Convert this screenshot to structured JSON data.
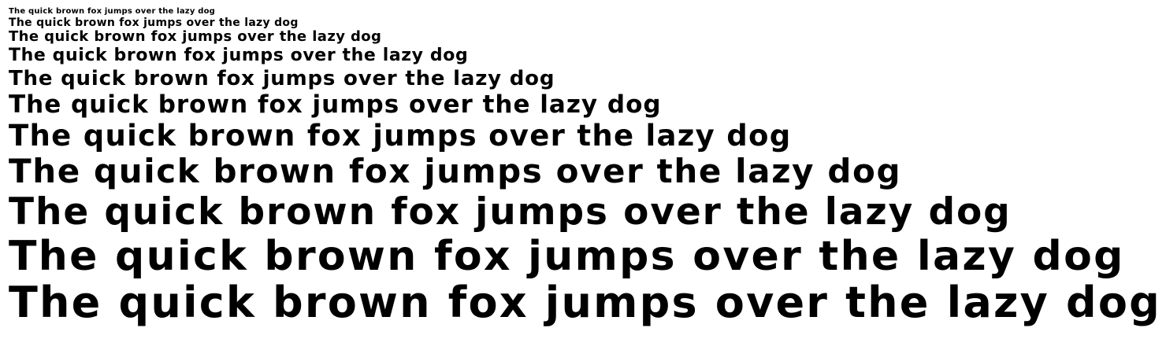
{
  "specimen": {
    "lines": [
      "The quick brown fox jumps over the lazy dog",
      "The quick brown fox jumps over the lazy dog",
      "The quick brown fox jumps over the lazy dog",
      "The quick brown fox jumps over the lazy dog",
      "The quick brown fox jumps over the lazy dog",
      "The quick brown fox jumps over the lazy dog",
      "The quick brown fox jumps over the lazy dog",
      "The quick brown fox jumps over the lazy dog",
      "The quick brown fox jumps over the lazy dog",
      "The quick brown fox jumps over the lazy dog",
      "The quick brown fox jumps over the lazy dog"
    ],
    "text_color": "#000000",
    "background_color": "#ffffff"
  }
}
